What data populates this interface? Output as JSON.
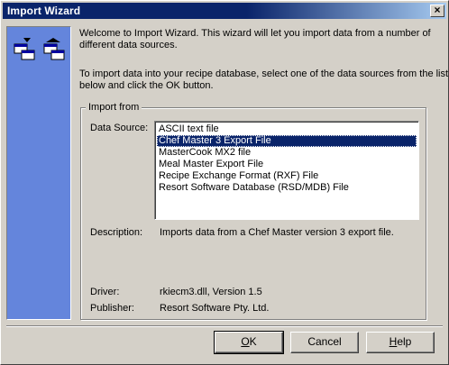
{
  "window": {
    "title": "Import Wizard",
    "close_symbol": "×"
  },
  "intro": {
    "line1": "Welcome to Import Wizard. This wizard will let you import data from a number of",
    "line2": "different data sources.",
    "line3": "To import data into your recipe database, select one of the data sources from the list",
    "line4": "below and click the OK button."
  },
  "import_from": {
    "legend": "Import from",
    "data_source_label": "Data Source:",
    "data_sources": [
      "ASCII text file",
      "Chef Master 3 Export File",
      "MasterCook MX2 file",
      "Meal Master Export File",
      "Recipe Exchange Format (RXF) File",
      "Resort Software Database (RSD/MDB) File"
    ],
    "selected_index": 1,
    "description_label": "Description:",
    "description_value": "Imports data from a Chef Master version 3 export file.",
    "driver_label": "Driver:",
    "driver_value": "rkiecm3.dll,  Version 1.5",
    "publisher_label": "Publisher:",
    "publisher_value": "Resort Software Pty. Ltd."
  },
  "buttons": {
    "ok": {
      "underlined": "O",
      "rest": "K"
    },
    "cancel": "Cancel",
    "help": {
      "underlined": "H",
      "rest": "elp"
    }
  },
  "colors": {
    "titlebar": "#0a246a",
    "side_panel": "#6485dc",
    "selection": "#0a246a",
    "face": "#d4d0c8"
  },
  "icons": [
    "wizard-icon"
  ]
}
